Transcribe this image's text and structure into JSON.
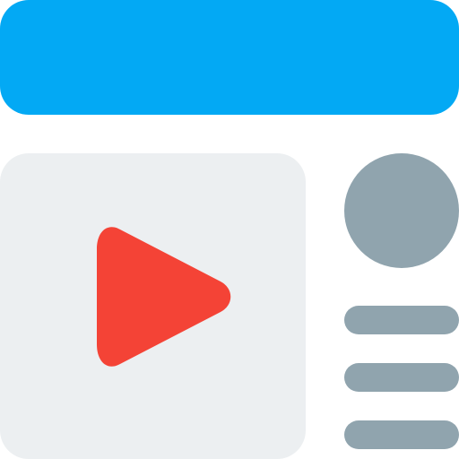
{
  "colors": {
    "header": "#03a9f4",
    "panel": "#eceff1",
    "play": "#f44336",
    "muted": "#90a4ae"
  },
  "icons": {
    "play": "play-icon",
    "avatar": "avatar",
    "text_lines": [
      "text-line-1",
      "text-line-2",
      "text-line-3"
    ]
  }
}
